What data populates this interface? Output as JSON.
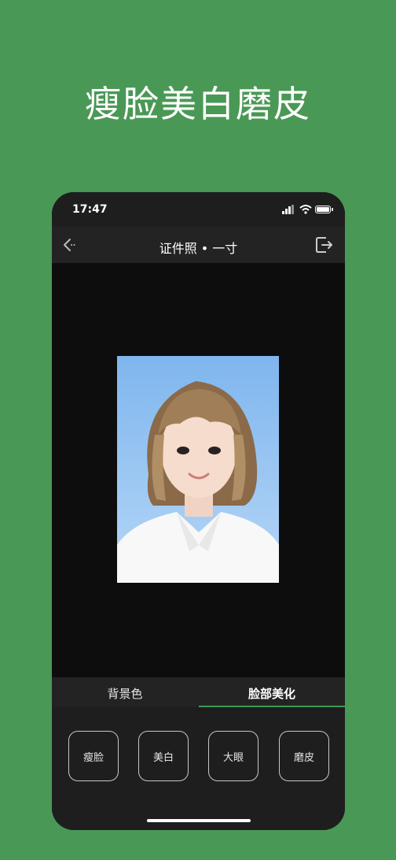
{
  "headline": "瘦脸美白磨皮",
  "status_bar": {
    "time": "17:47"
  },
  "nav": {
    "title": "证件照 • 一寸",
    "back_icon": "back-arrow-icon",
    "share_icon": "share-export-icon"
  },
  "tabs": [
    {
      "label": "背景色",
      "active": false
    },
    {
      "label": "脸部美化",
      "active": true
    }
  ],
  "tools": [
    {
      "label": "瘦脸"
    },
    {
      "label": "美白"
    },
    {
      "label": "大眼"
    },
    {
      "label": "磨皮"
    }
  ],
  "colors": {
    "page_background": "#4a9856",
    "phone_background": "#0d0d0d",
    "active_tab_indicator": "#3e9a52",
    "photo_background": "#7fb6ee"
  }
}
